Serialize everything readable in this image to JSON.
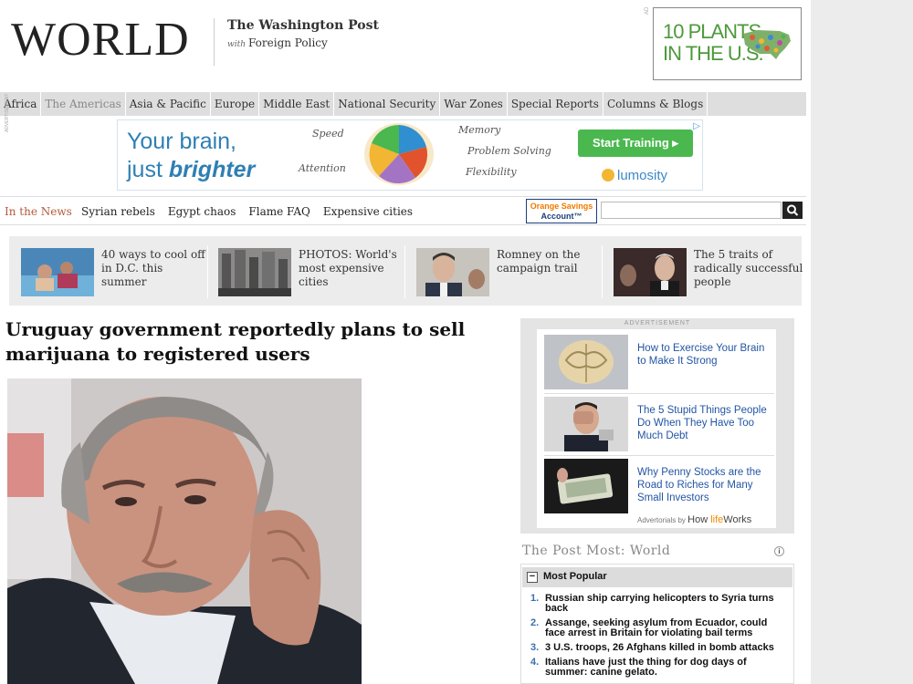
{
  "masthead": {
    "section_title": "WORLD",
    "publisher": "The Washington Post",
    "with_label": "with",
    "partner": "Foreign Policy"
  },
  "top_ad": {
    "label": "AD",
    "text_line1": "10 PLANTS",
    "text_line2": "IN THE U.S."
  },
  "nav": {
    "items": [
      "Africa",
      "The Americas",
      "Asia & Pacific",
      "Europe",
      "Middle East",
      "National Security",
      "War Zones",
      "Special Reports",
      "Columns & Blogs"
    ],
    "active": "The Americas"
  },
  "lumosity_ad": {
    "side_label": "ADVERTISEMENT",
    "headline_1": "Your brain,",
    "headline_2a": "just ",
    "headline_2b": "brighter",
    "labels": [
      "Speed",
      "Attention",
      "Memory",
      "Problem Solving",
      "Flexibility"
    ],
    "button": "Start Training ▸",
    "logo": "lumosity",
    "adchoices": "▷"
  },
  "in_the_news": {
    "label": "In the News",
    "links": [
      "Syrian rebels",
      "Egypt chaos",
      "Flame FAQ",
      "Expensive cities"
    ],
    "sponsor_line1": "Orange Savings",
    "sponsor_line2": "Account™",
    "search_placeholder": ""
  },
  "promos": [
    {
      "text": "40 ways to cool off in D.C. this summer"
    },
    {
      "text": "PHOTOS: World's most expensive cities"
    },
    {
      "text": "Romney on the campaign trail"
    },
    {
      "text": "The 5 traits of radically successful people"
    }
  ],
  "article": {
    "headline": "Uruguay government reportedly plans to sell marijuana to registered users"
  },
  "right_ad": {
    "label": "ADVERTISEMENT",
    "items": [
      {
        "text": "How to Exercise Your Brain to Make It Strong"
      },
      {
        "text": "The 5 Stupid Things People Do When They Have Too Much Debt"
      },
      {
        "text": "Why Penny Stocks are the Road to Riches for Many Small Investors"
      }
    ],
    "footer_prefix": "Advertorials by",
    "footer_brand_a": "How ",
    "footer_brand_b": "life",
    "footer_brand_c": "Works"
  },
  "post_most": {
    "title": "The Post Most: World",
    "tab": "Most Popular",
    "items": [
      {
        "num": "1.",
        "text": "Russian ship carrying helicopters to Syria turns back"
      },
      {
        "num": "2.",
        "text": "Assange, seeking asylum from Ecuador, could face arrest in Britain for violating bail terms"
      },
      {
        "num": "3.",
        "text": "3 U.S. troops, 26 Afghans killed in bomb attacks"
      },
      {
        "num": "4.",
        "text": "Italians have just the thing for dog days of summer: canine gelato."
      }
    ]
  }
}
